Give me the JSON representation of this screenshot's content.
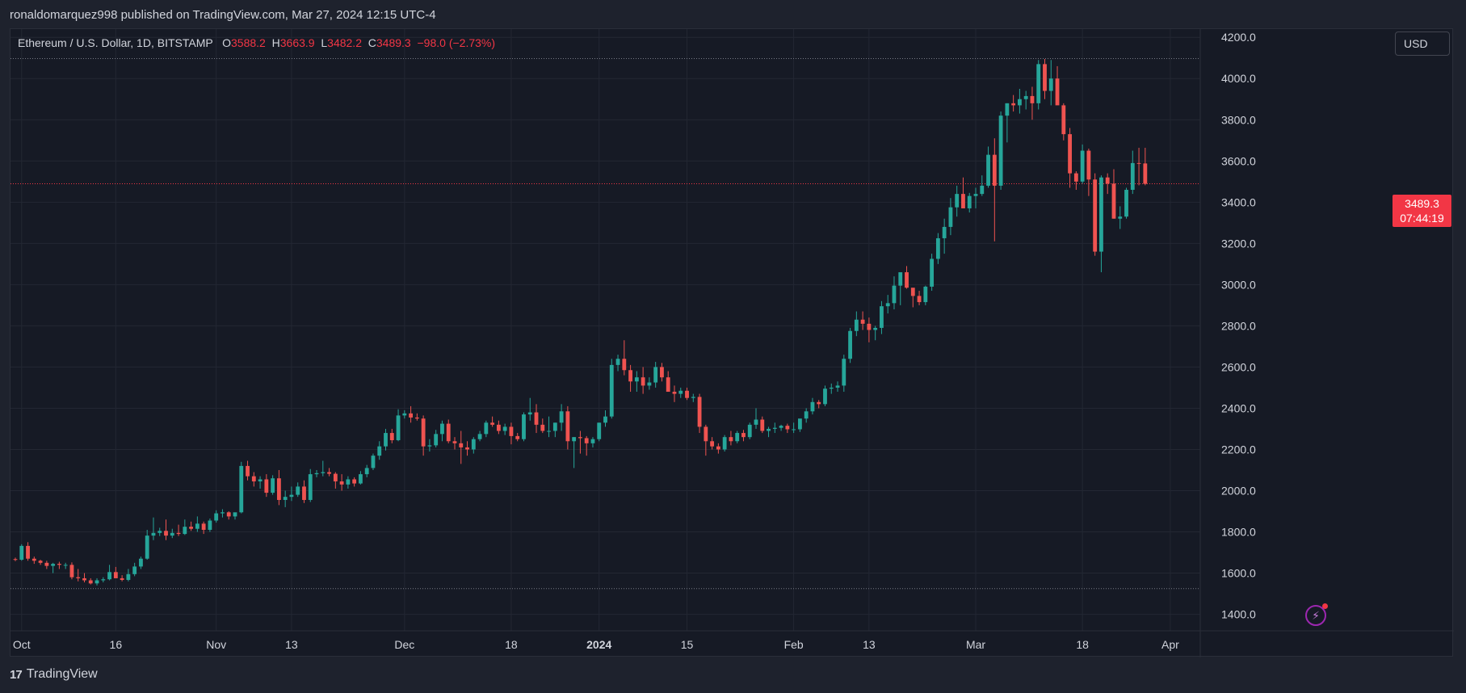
{
  "header": {
    "publish_text": "ronaldomarquez998 published on TradingView.com, Mar 27, 2024 12:15 UTC-4"
  },
  "legend": {
    "symbol": "Ethereum / U.S. Dollar, 1D, BITSTAMP",
    "o_label": "O",
    "o_value": "3588.2",
    "h_label": "H",
    "h_value": "3663.9",
    "l_label": "L",
    "l_value": "3482.2",
    "c_label": "C",
    "c_value": "3489.3",
    "change": "−98.0 (−2.73%)"
  },
  "price_axis": {
    "currency_button": "USD",
    "last_price": "3489.3",
    "countdown": "07:44:19"
  },
  "footer": {
    "brand": "TradingView",
    "brand_mark": "17"
  },
  "colors": {
    "up": "#26a69a",
    "down": "#ef5350",
    "background": "#161a25",
    "grid": "#232733",
    "axis_text": "#d1d4dc",
    "price_line": "#f23645"
  },
  "icons": {
    "flash": "lightning-icon"
  },
  "chart_data": {
    "type": "candlestick",
    "ylim": [
      1320,
      4240
    ],
    "y_ticks": [
      1400,
      1600,
      1800,
      2000,
      2200,
      2400,
      2600,
      2800,
      3000,
      3200,
      3400,
      3600,
      3800,
      4000,
      4200
    ],
    "y_tick_labels": [
      "1400.0",
      "1600.0",
      "1800.0",
      "2000.0",
      "2200.0",
      "2400.0",
      "2600.0",
      "2800.0",
      "3000.0",
      "3200.0",
      "3400.0",
      "3600.0",
      "3800.0",
      "4000.0",
      "4200.0"
    ],
    "x_labels": [
      {
        "label": "Oct",
        "date": "2023-10-01"
      },
      {
        "label": "16",
        "date": "2023-10-16"
      },
      {
        "label": "Nov",
        "date": "2023-11-01"
      },
      {
        "label": "13",
        "date": "2023-11-13"
      },
      {
        "label": "Dec",
        "date": "2023-12-01"
      },
      {
        "label": "18",
        "date": "2023-12-18"
      },
      {
        "label": "2024",
        "date": "2024-01-01"
      },
      {
        "label": "15",
        "date": "2024-01-15"
      },
      {
        "label": "Feb",
        "date": "2024-02-01"
      },
      {
        "label": "13",
        "date": "2024-02-13"
      },
      {
        "label": "Mar",
        "date": "2024-03-01"
      },
      {
        "label": "18",
        "date": "2024-03-18"
      },
      {
        "label": "Apr",
        "date": "2024-04-01"
      }
    ],
    "first_date": "2023-09-30",
    "x_max_date": "2024-04-05",
    "reference_lines": [
      4097,
      1525
    ],
    "last_price": 3489.3,
    "ohlc": [
      [
        1668,
        1675,
        1658,
        1665
      ],
      [
        1665,
        1740,
        1660,
        1732
      ],
      [
        1732,
        1750,
        1660,
        1670
      ],
      [
        1670,
        1680,
        1645,
        1660
      ],
      [
        1660,
        1665,
        1640,
        1650
      ],
      [
        1650,
        1660,
        1620,
        1635
      ],
      [
        1635,
        1650,
        1600,
        1645
      ],
      [
        1645,
        1655,
        1620,
        1640
      ],
      [
        1640,
        1650,
        1620,
        1640
      ],
      [
        1640,
        1652,
        1570,
        1580
      ],
      [
        1580,
        1620,
        1560,
        1575
      ],
      [
        1575,
        1600,
        1555,
        1565
      ],
      [
        1565,
        1575,
        1545,
        1550
      ],
      [
        1550,
        1575,
        1540,
        1565
      ],
      [
        1565,
        1580,
        1555,
        1570
      ],
      [
        1570,
        1640,
        1565,
        1605
      ],
      [
        1605,
        1630,
        1585,
        1575
      ],
      [
        1575,
        1590,
        1560,
        1567
      ],
      [
        1567,
        1620,
        1560,
        1595
      ],
      [
        1595,
        1650,
        1585,
        1632
      ],
      [
        1632,
        1680,
        1620,
        1670
      ],
      [
        1670,
        1810,
        1665,
        1782
      ],
      [
        1782,
        1870,
        1760,
        1795
      ],
      [
        1795,
        1820,
        1780,
        1805
      ],
      [
        1805,
        1860,
        1760,
        1782
      ],
      [
        1782,
        1815,
        1770,
        1795
      ],
      [
        1795,
        1835,
        1780,
        1790
      ],
      [
        1790,
        1860,
        1785,
        1825
      ],
      [
        1825,
        1850,
        1805,
        1815
      ],
      [
        1815,
        1875,
        1800,
        1840
      ],
      [
        1840,
        1850,
        1790,
        1810
      ],
      [
        1810,
        1865,
        1800,
        1855
      ],
      [
        1855,
        1905,
        1845,
        1890
      ],
      [
        1890,
        1910,
        1870,
        1895
      ],
      [
        1895,
        1900,
        1860,
        1875
      ],
      [
        1875,
        1890,
        1860,
        1895
      ],
      [
        1895,
        2140,
        1890,
        2120
      ],
      [
        2120,
        2145,
        2050,
        2070
      ],
      [
        2070,
        2090,
        2020,
        2045
      ],
      [
        2045,
        2070,
        2010,
        2055
      ],
      [
        2055,
        2080,
        1970,
        1990
      ],
      [
        1990,
        2075,
        1980,
        2060
      ],
      [
        2060,
        2100,
        1930,
        1955
      ],
      [
        1955,
        2000,
        1920,
        1970
      ],
      [
        1970,
        2020,
        1950,
        1980
      ],
      [
        1980,
        2040,
        1970,
        2020
      ],
      [
        2020,
        2050,
        1940,
        1955
      ],
      [
        1955,
        2105,
        1945,
        2080
      ],
      [
        2080,
        2100,
        2065,
        2085
      ],
      [
        2085,
        2145,
        2070,
        2090
      ],
      [
        2090,
        2110,
        2070,
        2082
      ],
      [
        2082,
        2090,
        2010,
        2045
      ],
      [
        2045,
        2080,
        2000,
        2030
      ],
      [
        2030,
        2070,
        2010,
        2055
      ],
      [
        2055,
        2065,
        2020,
        2035
      ],
      [
        2035,
        2095,
        2030,
        2080
      ],
      [
        2080,
        2125,
        2065,
        2110
      ],
      [
        2110,
        2180,
        2100,
        2170
      ],
      [
        2170,
        2240,
        2150,
        2215
      ],
      [
        2215,
        2300,
        2195,
        2280
      ],
      [
        2280,
        2300,
        2230,
        2245
      ],
      [
        2245,
        2395,
        2240,
        2365
      ],
      [
        2365,
        2390,
        2350,
        2375
      ],
      [
        2375,
        2410,
        2330,
        2355
      ],
      [
        2355,
        2375,
        2340,
        2350
      ],
      [
        2350,
        2365,
        2170,
        2215
      ],
      [
        2215,
        2250,
        2190,
        2220
      ],
      [
        2220,
        2295,
        2210,
        2275
      ],
      [
        2275,
        2340,
        2240,
        2325
      ],
      [
        2325,
        2345,
        2230,
        2240
      ],
      [
        2240,
        2260,
        2200,
        2230
      ],
      [
        2230,
        2290,
        2130,
        2210
      ],
      [
        2210,
        2240,
        2170,
        2200
      ],
      [
        2200,
        2260,
        2180,
        2250
      ],
      [
        2250,
        2290,
        2240,
        2275
      ],
      [
        2275,
        2340,
        2260,
        2330
      ],
      [
        2330,
        2360,
        2310,
        2320
      ],
      [
        2320,
        2340,
        2275,
        2290
      ],
      [
        2290,
        2325,
        2270,
        2310
      ],
      [
        2310,
        2330,
        2225,
        2265
      ],
      [
        2265,
        2280,
        2240,
        2250
      ],
      [
        2250,
        2380,
        2240,
        2370
      ],
      [
        2370,
        2450,
        2340,
        2380
      ],
      [
        2380,
        2420,
        2280,
        2320
      ],
      [
        2320,
        2350,
        2280,
        2290
      ],
      [
        2290,
        2360,
        2260,
        2290
      ],
      [
        2290,
        2330,
        2260,
        2330
      ],
      [
        2330,
        2420,
        2290,
        2385
      ],
      [
        2385,
        2410,
        2200,
        2240
      ],
      [
        2240,
        2260,
        2110,
        2260
      ],
      [
        2260,
        2290,
        2180,
        2255
      ],
      [
        2255,
        2265,
        2170,
        2230
      ],
      [
        2230,
        2260,
        2210,
        2250
      ],
      [
        2250,
        2330,
        2240,
        2330
      ],
      [
        2330,
        2390,
        2310,
        2360
      ],
      [
        2360,
        2640,
        2350,
        2610
      ],
      [
        2610,
        2660,
        2580,
        2640
      ],
      [
        2640,
        2730,
        2560,
        2585
      ],
      [
        2585,
        2610,
        2480,
        2530
      ],
      [
        2530,
        2580,
        2480,
        2550
      ],
      [
        2550,
        2600,
        2470,
        2510
      ],
      [
        2510,
        2550,
        2490,
        2525
      ],
      [
        2525,
        2625,
        2500,
        2600
      ],
      [
        2600,
        2620,
        2530,
        2550
      ],
      [
        2550,
        2580,
        2490,
        2480
      ],
      [
        2480,
        2510,
        2430,
        2470
      ],
      [
        2470,
        2500,
        2450,
        2485
      ],
      [
        2485,
        2500,
        2440,
        2450
      ],
      [
        2450,
        2470,
        2430,
        2455
      ],
      [
        2455,
        2470,
        2280,
        2310
      ],
      [
        2310,
        2320,
        2170,
        2240
      ],
      [
        2240,
        2260,
        2200,
        2215
      ],
      [
        2215,
        2230,
        2180,
        2200
      ],
      [
        2200,
        2270,
        2190,
        2260
      ],
      [
        2260,
        2290,
        2220,
        2240
      ],
      [
        2240,
        2290,
        2230,
        2280
      ],
      [
        2280,
        2295,
        2240,
        2260
      ],
      [
        2260,
        2330,
        2250,
        2320
      ],
      [
        2320,
        2400,
        2300,
        2345
      ],
      [
        2345,
        2360,
        2280,
        2290
      ],
      [
        2290,
        2310,
        2260,
        2300
      ],
      [
        2300,
        2330,
        2280,
        2305
      ],
      [
        2305,
        2320,
        2290,
        2315
      ],
      [
        2315,
        2325,
        2280,
        2298
      ],
      [
        2298,
        2330,
        2280,
        2298
      ],
      [
        2298,
        2340,
        2285,
        2350
      ],
      [
        2350,
        2400,
        2330,
        2385
      ],
      [
        2385,
        2450,
        2370,
        2430
      ],
      [
        2430,
        2440,
        2400,
        2420
      ],
      [
        2420,
        2510,
        2410,
        2495
      ],
      [
        2495,
        2520,
        2470,
        2500
      ],
      [
        2500,
        2530,
        2480,
        2510
      ],
      [
        2510,
        2660,
        2480,
        2640
      ],
      [
        2640,
        2790,
        2620,
        2775
      ],
      [
        2775,
        2870,
        2750,
        2830
      ],
      [
        2830,
        2870,
        2780,
        2810
      ],
      [
        2810,
        2840,
        2720,
        2780
      ],
      [
        2780,
        2800,
        2730,
        2790
      ],
      [
        2790,
        2920,
        2760,
        2895
      ],
      [
        2895,
        2950,
        2860,
        2910
      ],
      [
        2910,
        3040,
        2880,
        2995
      ],
      [
        2995,
        3010,
        2900,
        3060
      ],
      [
        3060,
        3090,
        2980,
        2985
      ],
      [
        2985,
        2980,
        2890,
        2945
      ],
      [
        2945,
        2970,
        2900,
        2915
      ],
      [
        2915,
        2995,
        2900,
        2990
      ],
      [
        2990,
        3150,
        2970,
        3125
      ],
      [
        3125,
        3250,
        3100,
        3225
      ],
      [
        3225,
        3320,
        3150,
        3280
      ],
      [
        3280,
        3420,
        3240,
        3375
      ],
      [
        3375,
        3480,
        3330,
        3440
      ],
      [
        3440,
        3520,
        3380,
        3370
      ],
      [
        3370,
        3445,
        3350,
        3430
      ],
      [
        3430,
        3470,
        3370,
        3440
      ],
      [
        3440,
        3530,
        3430,
        3480
      ],
      [
        3480,
        3670,
        3470,
        3630
      ],
      [
        3630,
        3710,
        3210,
        3480
      ],
      [
        3480,
        3840,
        3460,
        3820
      ],
      [
        3820,
        3880,
        3690,
        3880
      ],
      [
        3880,
        3920,
        3840,
        3870
      ],
      [
        3870,
        3950,
        3830,
        3900
      ],
      [
        3900,
        3940,
        3850,
        3915
      ],
      [
        3915,
        3960,
        3800,
        3880
      ],
      [
        3880,
        4090,
        3850,
        4070
      ],
      [
        4070,
        4095,
        3900,
        3940
      ],
      [
        3940,
        4090,
        3870,
        4000
      ],
      [
        4000,
        4060,
        3880,
        3870
      ],
      [
        3870,
        3880,
        3700,
        3730
      ],
      [
        3730,
        3760,
        3470,
        3540
      ],
      [
        3540,
        3550,
        3460,
        3500
      ],
      [
        3500,
        3680,
        3490,
        3650
      ],
      [
        3650,
        3660,
        3430,
        3510
      ],
      [
        3510,
        3540,
        3140,
        3160
      ],
      [
        3160,
        3530,
        3060,
        3520
      ],
      [
        3520,
        3540,
        3440,
        3490
      ],
      [
        3490,
        3560,
        3320,
        3320
      ],
      [
        3320,
        3380,
        3270,
        3330
      ],
      [
        3330,
        3470,
        3320,
        3460
      ],
      [
        3460,
        3650,
        3440,
        3590
      ],
      [
        3590,
        3664,
        3482,
        3588
      ],
      [
        3588,
        3664,
        3482,
        3489
      ]
    ]
  }
}
